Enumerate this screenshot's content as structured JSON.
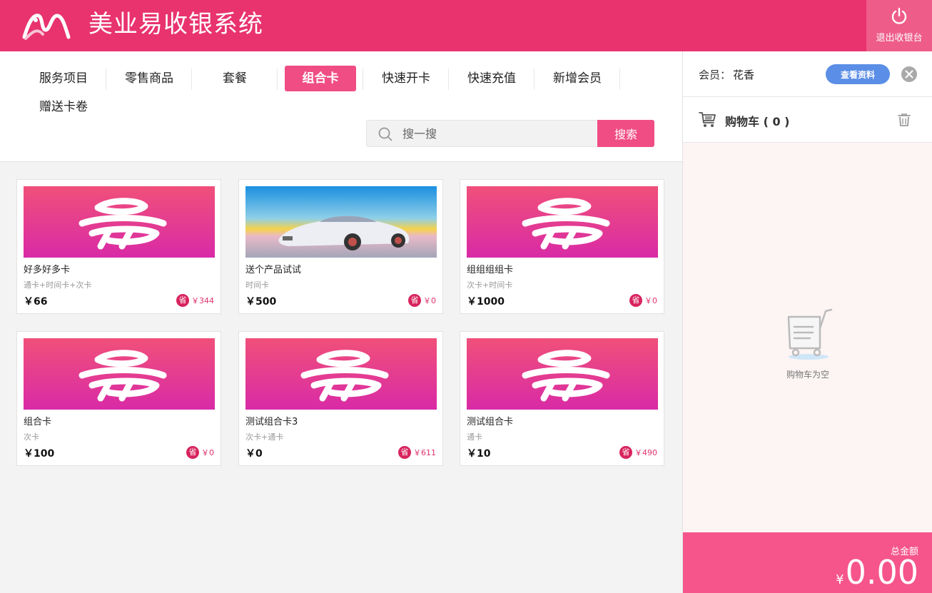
{
  "header": {
    "title": "美业易收银系统",
    "logout_label": "退出收银台"
  },
  "tabs": [
    {
      "label": "服务项目",
      "active": false
    },
    {
      "label": "零售商品",
      "active": false
    },
    {
      "label": "套餐",
      "active": false
    },
    {
      "label": "组合卡",
      "active": true
    },
    {
      "label": "快速开卡",
      "active": false
    },
    {
      "label": "快速充值",
      "active": false
    },
    {
      "label": "新增会员",
      "active": false
    },
    {
      "label": "赠送卡卷",
      "active": false
    }
  ],
  "search": {
    "placeholder": "搜一搜",
    "button_label": "搜索"
  },
  "products": [
    {
      "name": "好多好多卡",
      "type": "通卡+时间卡+次卡",
      "price": "￥66",
      "save_icon": "省",
      "save": "￥344",
      "image": "logo"
    },
    {
      "name": "送个产品试试",
      "type": "时间卡",
      "price": "￥500",
      "save_icon": "省",
      "save": "￥0",
      "image": "car"
    },
    {
      "name": "组组组组卡",
      "type": "次卡+时间卡",
      "price": "￥1000",
      "save_icon": "省",
      "save": "￥0",
      "image": "logo"
    },
    {
      "name": "组合卡",
      "type": "次卡",
      "price": "￥100",
      "save_icon": "省",
      "save": "￥0",
      "image": "logo"
    },
    {
      "name": "测试组合卡3",
      "type": "次卡+通卡",
      "price": "￥0",
      "save_icon": "省",
      "save": "￥611",
      "image": "logo"
    },
    {
      "name": "测试组合卡",
      "type": "通卡",
      "price": "￥10",
      "save_icon": "省",
      "save": "￥490",
      "image": "logo"
    }
  ],
  "member": {
    "label": "会员：",
    "name": "花香",
    "view_button": "查看资料"
  },
  "cart": {
    "title": "购物车 ( 0 )",
    "empty_text": "购物车为空"
  },
  "total": {
    "label": "总金额",
    "currency": "¥",
    "amount": "0.00"
  },
  "colors": {
    "brand": "#e8336f",
    "accent": "#f04d84",
    "button_blue": "#5b8ee6",
    "total_bar": "#f5558b"
  }
}
